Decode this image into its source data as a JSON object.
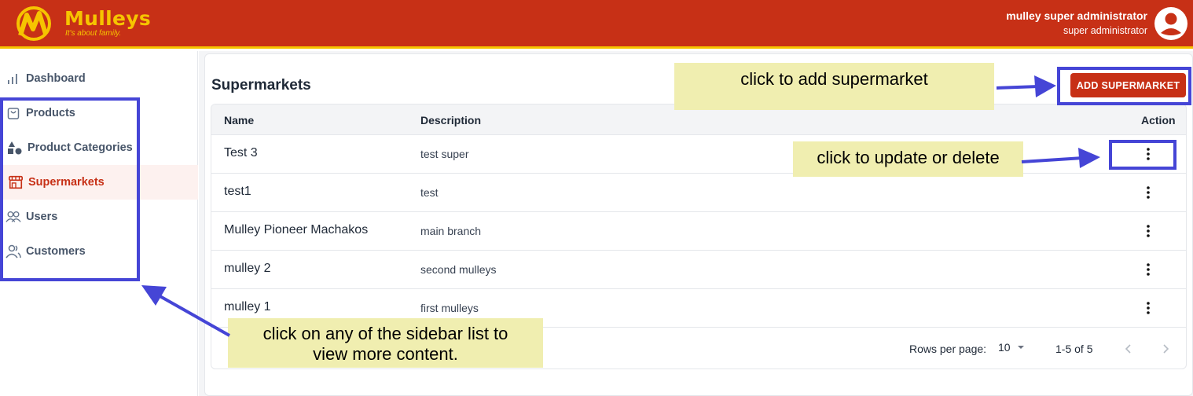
{
  "header": {
    "brand": "Mulleys",
    "tagline": "It's about family.",
    "user_name": "mulley super administrator",
    "user_role": "super administrator"
  },
  "sidebar": {
    "items": [
      {
        "label": "Dashboard",
        "icon": "bar-chart-icon"
      },
      {
        "label": "Products",
        "icon": "shopping-bag-icon"
      },
      {
        "label": "Product Categories",
        "icon": "shapes-icon"
      },
      {
        "label": "Supermarkets",
        "icon": "storefront-icon",
        "active": true
      },
      {
        "label": "Users",
        "icon": "users-icon"
      },
      {
        "label": "Customers",
        "icon": "customers-icon"
      }
    ]
  },
  "main": {
    "title": "Supermarkets",
    "add_button": "ADD SUPERMARKET",
    "table": {
      "headers": {
        "name": "Name",
        "description": "Description",
        "action": "Action"
      },
      "rows": [
        {
          "name": "Test 3",
          "description": "test super"
        },
        {
          "name": "test1",
          "description": "test"
        },
        {
          "name": "Mulley Pioneer Machakos",
          "description": "main branch"
        },
        {
          "name": "mulley 2",
          "description": "second mulleys"
        },
        {
          "name": "mulley 1",
          "description": "first mulleys"
        }
      ]
    },
    "pagination": {
      "rows_per_page_label": "Rows per page:",
      "rows_per_page": "10",
      "range": "1-5 of 5"
    }
  },
  "annotations": {
    "add": "click to add supermarket",
    "update": "click to update or delete",
    "sidebar_line1": "click on any of the sidebar list to",
    "sidebar_line2": "view more content."
  },
  "colors": {
    "brand_red": "#c73016",
    "brand_yellow": "#f6c400",
    "annotation_blue": "#4545d6",
    "callout_bg": "#f0eeb0"
  }
}
